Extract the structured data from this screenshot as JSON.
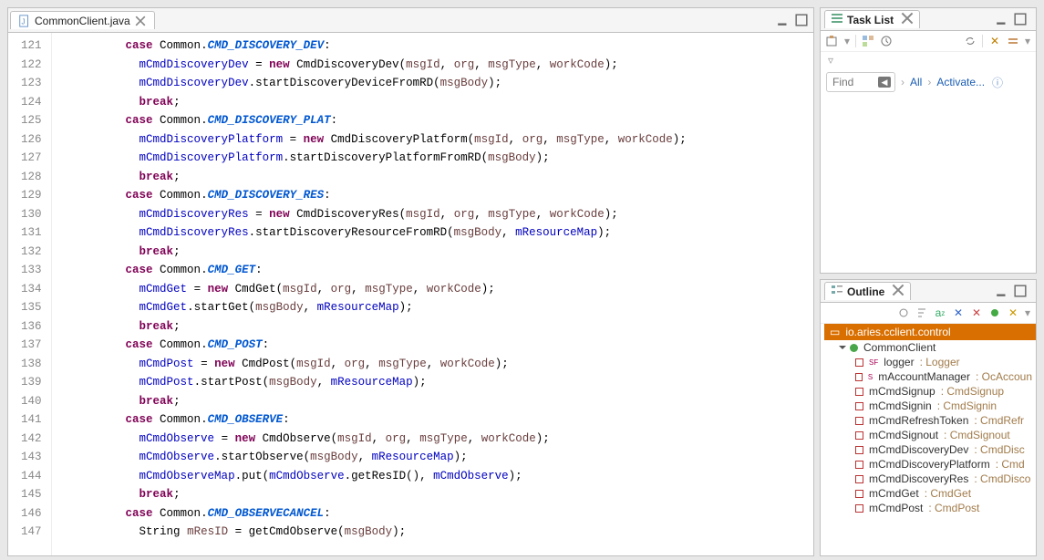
{
  "editor": {
    "filename": "CommonClient.java",
    "first_line": 121,
    "tokens": [
      [
        "case ",
        "kw",
        "Common",
        "cls",
        ".",
        "punc",
        "CMD_DISCOVERY_DEV",
        "const",
        ":",
        "punc"
      ],
      [
        "  ",
        "",
        "mCmdDiscoveryDev",
        "fld",
        " = ",
        "punc",
        "new ",
        "kw",
        "CmdDiscoveryDev",
        "cls",
        "(",
        "punc",
        "msgId",
        "param",
        ", ",
        "punc",
        "org",
        "param",
        ", ",
        "punc",
        "msgType",
        "param",
        ", ",
        "punc",
        "workCode",
        "param",
        ");",
        "punc"
      ],
      [
        "  ",
        "",
        "mCmdDiscoveryDev",
        "fld",
        ".startDiscoveryDeviceFromRD(",
        "mtd",
        "msgBody",
        "param",
        ");",
        "punc"
      ],
      [
        "  ",
        "",
        "break",
        "kw",
        ";",
        "punc"
      ],
      [
        "case ",
        "kw",
        "Common",
        "cls",
        ".",
        "punc",
        "CMD_DISCOVERY_PLAT",
        "const",
        ":",
        "punc"
      ],
      [
        "  ",
        "",
        "mCmdDiscoveryPlatform",
        "fld",
        " = ",
        "punc",
        "new ",
        "kw",
        "CmdDiscoveryPlatform",
        "cls",
        "(",
        "punc",
        "msgId",
        "param",
        ", ",
        "punc",
        "org",
        "param",
        ", ",
        "punc",
        "msgType",
        "param",
        ", ",
        "punc",
        "workCode",
        "param",
        ");",
        "punc"
      ],
      [
        "  ",
        "",
        "mCmdDiscoveryPlatform",
        "fld",
        ".startDiscoveryPlatformFromRD(",
        "mtd",
        "msgBody",
        "param",
        ");",
        "punc"
      ],
      [
        "  ",
        "",
        "break",
        "kw",
        ";",
        "punc"
      ],
      [
        "case ",
        "kw",
        "Common",
        "cls",
        ".",
        "punc",
        "CMD_DISCOVERY_RES",
        "const",
        ":",
        "punc"
      ],
      [
        "  ",
        "",
        "mCmdDiscoveryRes",
        "fld",
        " = ",
        "punc",
        "new ",
        "kw",
        "CmdDiscoveryRes",
        "cls",
        "(",
        "punc",
        "msgId",
        "param",
        ", ",
        "punc",
        "org",
        "param",
        ", ",
        "punc",
        "msgType",
        "param",
        ", ",
        "punc",
        "workCode",
        "param",
        ");",
        "punc"
      ],
      [
        "  ",
        "",
        "mCmdDiscoveryRes",
        "fld",
        ".startDiscoveryResourceFromRD(",
        "mtd",
        "msgBody",
        "param",
        ", ",
        "punc",
        "mResourceMap",
        "fld",
        ");",
        "punc"
      ],
      [
        "  ",
        "",
        "break",
        "kw",
        ";",
        "punc"
      ],
      [
        "case ",
        "kw",
        "Common",
        "cls",
        ".",
        "punc",
        "CMD_GET",
        "const",
        ":",
        "punc"
      ],
      [
        "  ",
        "",
        "mCmdGet",
        "fld",
        " = ",
        "punc",
        "new ",
        "kw",
        "CmdGet",
        "cls",
        "(",
        "punc",
        "msgId",
        "param",
        ", ",
        "punc",
        "org",
        "param",
        ", ",
        "punc",
        "msgType",
        "param",
        ", ",
        "punc",
        "workCode",
        "param",
        ");",
        "punc"
      ],
      [
        "  ",
        "",
        "mCmdGet",
        "fld",
        ".startGet(",
        "mtd",
        "msgBody",
        "param",
        ", ",
        "punc",
        "mResourceMap",
        "fld",
        ");",
        "punc"
      ],
      [
        "  ",
        "",
        "break",
        "kw",
        ";",
        "punc"
      ],
      [
        "case ",
        "kw",
        "Common",
        "cls",
        ".",
        "punc",
        "CMD_POST",
        "const",
        ":",
        "punc"
      ],
      [
        "  ",
        "",
        "mCmdPost",
        "fld",
        " = ",
        "punc",
        "new ",
        "kw",
        "CmdPost",
        "cls",
        "(",
        "punc",
        "msgId",
        "param",
        ", ",
        "punc",
        "org",
        "param",
        ", ",
        "punc",
        "msgType",
        "param",
        ", ",
        "punc",
        "workCode",
        "param",
        ");",
        "punc"
      ],
      [
        "  ",
        "",
        "mCmdPost",
        "fld",
        ".startPost(",
        "mtd",
        "msgBody",
        "param",
        ", ",
        "punc",
        "mResourceMap",
        "fld",
        ");",
        "punc"
      ],
      [
        "  ",
        "",
        "break",
        "kw",
        ";",
        "punc"
      ],
      [
        "case ",
        "kw",
        "Common",
        "cls",
        ".",
        "punc",
        "CMD_OBSERVE",
        "const",
        ":",
        "punc"
      ],
      [
        "  ",
        "",
        "mCmdObserve",
        "fld",
        " = ",
        "punc",
        "new ",
        "kw",
        "CmdObserve",
        "cls",
        "(",
        "punc",
        "msgId",
        "param",
        ", ",
        "punc",
        "org",
        "param",
        ", ",
        "punc",
        "msgType",
        "param",
        ", ",
        "punc",
        "workCode",
        "param",
        ");",
        "punc"
      ],
      [
        "  ",
        "",
        "mCmdObserve",
        "fld",
        ".startObserve(",
        "mtd",
        "msgBody",
        "param",
        ", ",
        "punc",
        "mResourceMap",
        "fld",
        ");",
        "punc"
      ],
      [
        "  ",
        "",
        "mCmdObserveMap",
        "fld",
        ".put(",
        "mtd",
        "mCmdObserve",
        "fld",
        ".getResID(), ",
        "mtd",
        "mCmdObserve",
        "fld",
        ");",
        "punc"
      ],
      [
        "  ",
        "",
        "break",
        "kw",
        ";",
        "punc"
      ],
      [
        "case ",
        "kw",
        "Common",
        "cls",
        ".",
        "punc",
        "CMD_OBSERVECANCEL",
        "const",
        ":",
        "punc"
      ],
      [
        "  ",
        "",
        "String ",
        "cls",
        "mResID",
        "param",
        " = getCmdObserve(",
        "mtd",
        "msgBody",
        "param",
        ");",
        "punc"
      ]
    ]
  },
  "tasklist": {
    "title": "Task List",
    "find_placeholder": "Find",
    "crumb_all": "All",
    "crumb_activate": "Activate..."
  },
  "outline": {
    "title": "Outline",
    "package": "io.aries.cclient.control",
    "class": "CommonClient",
    "members": [
      {
        "name": "logger",
        "type": "Logger",
        "mod": "sf"
      },
      {
        "name": "mAccountManager",
        "type": "OcAccoun",
        "mod": "s"
      },
      {
        "name": "mCmdSignup",
        "type": "CmdSignup"
      },
      {
        "name": "mCmdSignin",
        "type": "CmdSignin"
      },
      {
        "name": "mCmdRefreshToken",
        "type": "CmdRefr"
      },
      {
        "name": "mCmdSignout",
        "type": "CmdSignout"
      },
      {
        "name": "mCmdDiscoveryDev",
        "type": "CmdDisc"
      },
      {
        "name": "mCmdDiscoveryPlatform",
        "type": "Cmd"
      },
      {
        "name": "mCmdDiscoveryRes",
        "type": "CmdDisco"
      },
      {
        "name": "mCmdGet",
        "type": "CmdGet"
      },
      {
        "name": "mCmdPost",
        "type": "CmdPost"
      }
    ]
  }
}
